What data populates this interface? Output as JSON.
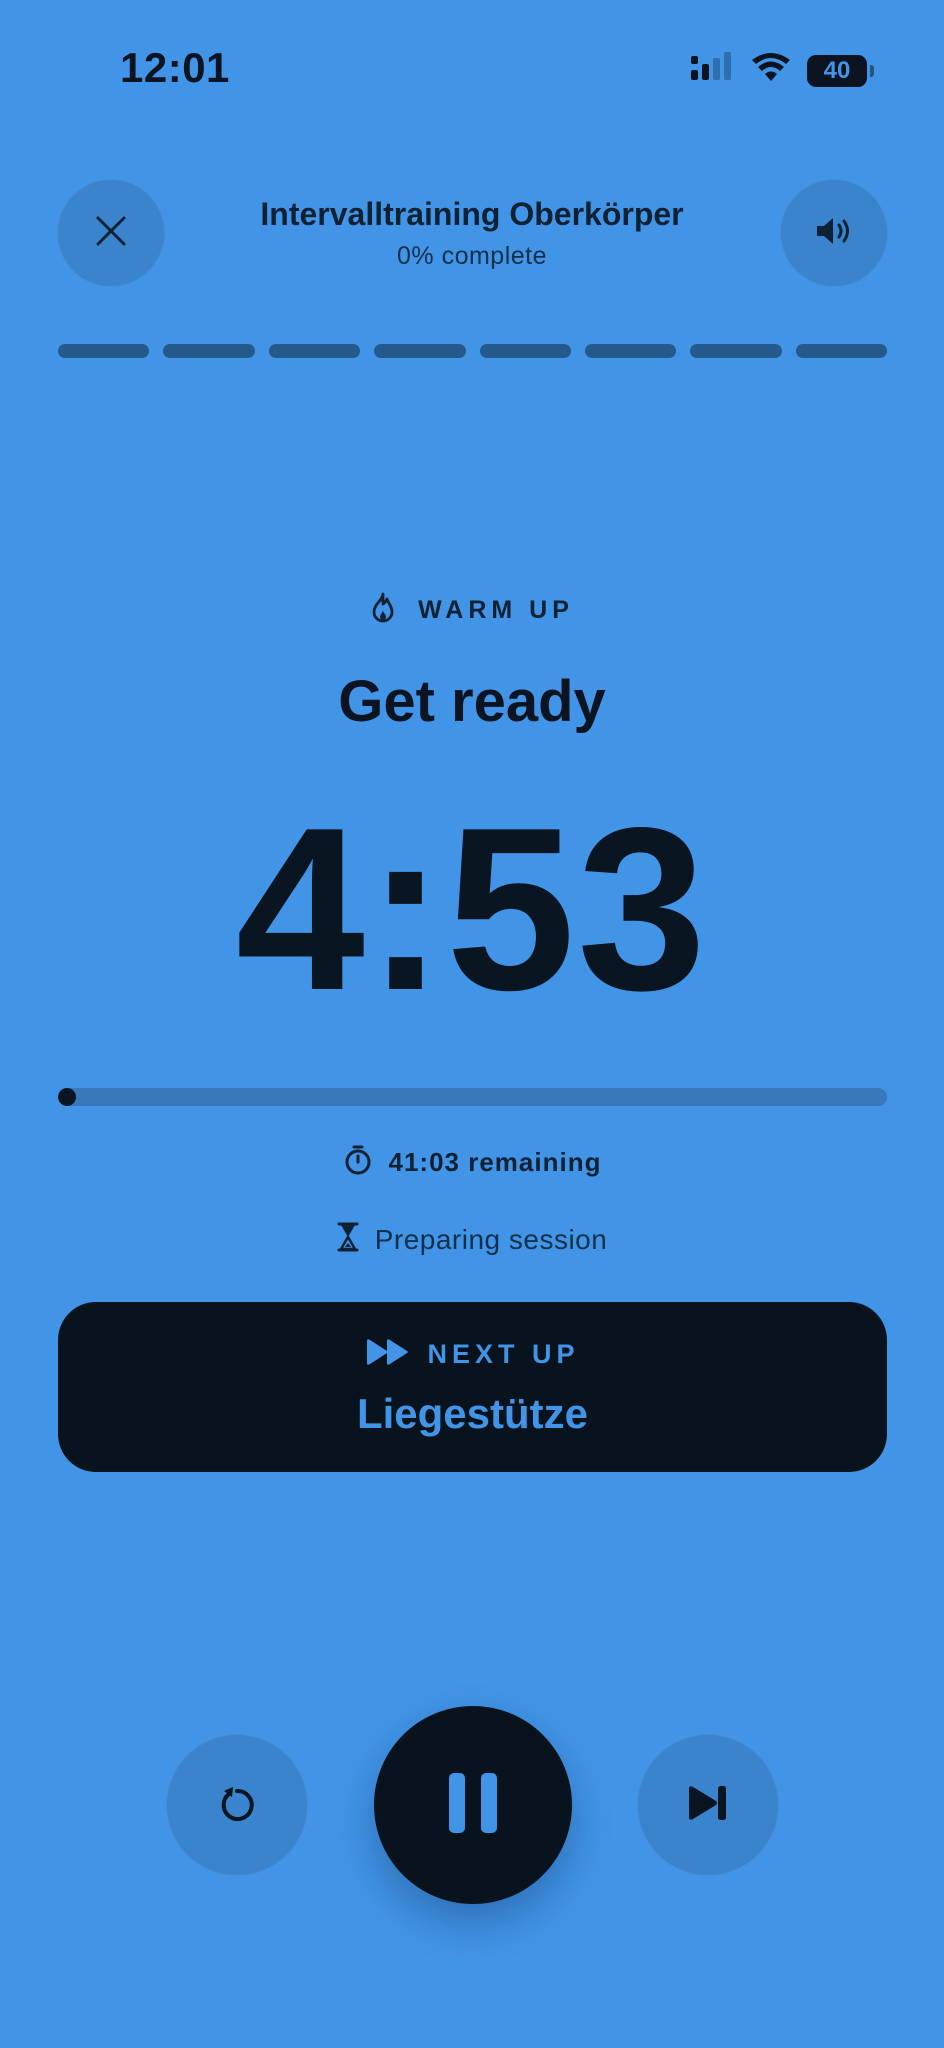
{
  "status_bar": {
    "time": "12:01",
    "battery": "40",
    "icons": [
      "signal-icon",
      "wifi-icon",
      "battery-icon"
    ]
  },
  "header": {
    "title": "Intervalltraining Oberkörper",
    "progress_text": "0% complete",
    "close_icon": "close-icon",
    "sound_icon": "speaker-icon"
  },
  "segments": {
    "count": 8
  },
  "phase": {
    "label": "WARM UP",
    "icon": "flame-icon",
    "title": "Get ready"
  },
  "timer": {
    "value": "4:53",
    "progress_fraction": 0.02
  },
  "session": {
    "remaining_text": "41:03 remaining",
    "remaining_icon": "stopwatch-icon",
    "status_text": "Preparing session",
    "status_icon": "hourglass-icon"
  },
  "next_up": {
    "label": "NEXT UP",
    "icon": "fast-forward-icon",
    "exercise": "Liegestütze"
  },
  "controls": {
    "restart_icon": "restart-icon",
    "pause_icon": "pause-icon",
    "skip_icon": "skip-next-icon"
  },
  "colors": {
    "background": "#4194E6",
    "dark": "#08131E",
    "accent_text": "#4194E6"
  }
}
